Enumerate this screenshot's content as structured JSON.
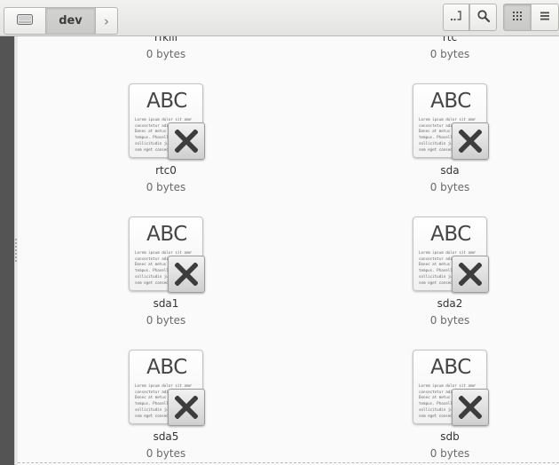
{
  "header": {
    "breadcrumb": [
      {
        "label": "",
        "icon": "drive-icon"
      },
      {
        "label": "dev"
      }
    ],
    "next_arrow": "›",
    "buttons": [
      "location-icon",
      "search-icon",
      "grid-view-icon",
      "list-view-icon"
    ],
    "active_view": "grid"
  },
  "files": {
    "partial_row": [
      {
        "name": "rfkill",
        "size": "0 bytes"
      },
      {
        "name": "rtc",
        "size": "0 bytes"
      }
    ],
    "items": [
      {
        "name": "rtc0",
        "size": "0 bytes"
      },
      {
        "name": "sda",
        "size": "0 bytes"
      },
      {
        "name": "sda1",
        "size": "0 bytes"
      },
      {
        "name": "sda2",
        "size": "0 bytes"
      },
      {
        "name": "sda5",
        "size": "0 bytes"
      },
      {
        "name": "sdb",
        "size": "0 bytes"
      }
    ],
    "icon_text": "ABC",
    "icon_lorem": "Lorem ipsum dolor sit amet,\nconsectetur adipiscing elit.\nDonec at metus ac felis\ntempus. Phasellus id orci\nsollicitudin justo dictum\nsem eget consequat lorem."
  },
  "colors": {
    "sidebar": "#545454",
    "content_bg": "#fafafa",
    "header_bg": "#e8e8e6"
  }
}
